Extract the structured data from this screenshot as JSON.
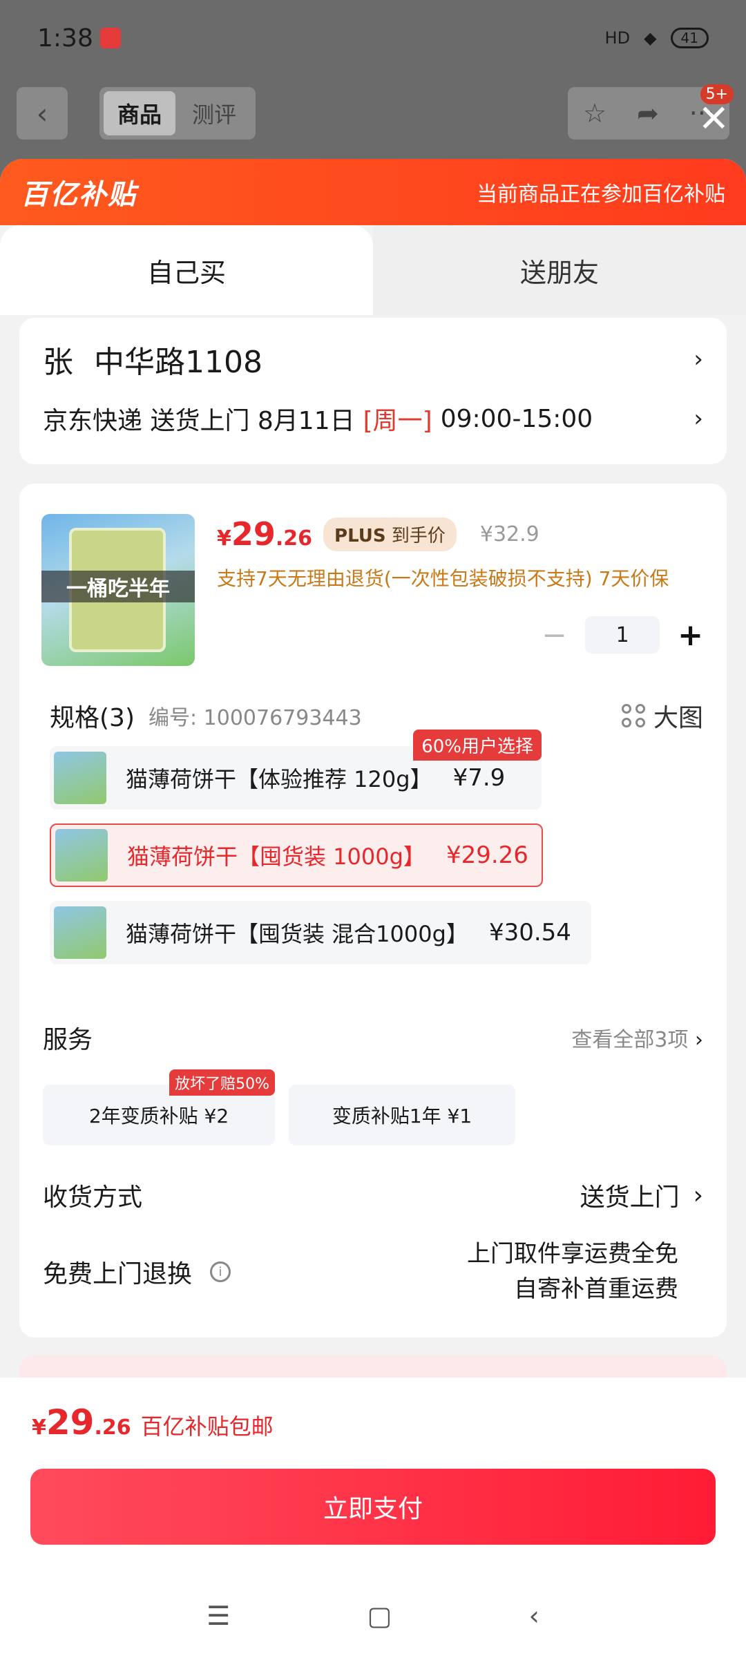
{
  "status": {
    "time": "1:38",
    "battery": "41",
    "signal": "HD"
  },
  "header": {
    "tab_active": "商品",
    "tab_inactive": "测评",
    "badge": "5+",
    "icons": [
      "back-icon",
      "star-icon",
      "share-icon",
      "more-icon",
      "close-icon"
    ]
  },
  "banner": {
    "logo": "百亿补贴",
    "text": "当前商品正在参加百亿补贴"
  },
  "tabs": {
    "self": "自己买",
    "friend": "送朋友"
  },
  "address": {
    "name": "张",
    "street": "中华路1108",
    "carrier": "京东快递 送货上门 8月11日",
    "weekday": "[周一]",
    "time": "09:00-15:00"
  },
  "product": {
    "image_overlay": "一桶吃半年",
    "price_symbol": "¥",
    "price_int": "29",
    "price_dec": ".26",
    "plus_label": "PLUS",
    "plus_text": "到手价",
    "old_price": "¥32.9",
    "return_note": "支持7天无理由退货(一次性包装破损不支持) 7天价保",
    "quantity": "1",
    "minus": "−",
    "plus": "+"
  },
  "spec": {
    "title": "规格(3)",
    "code": "编号: 100076793443",
    "big_image": "大图",
    "options": [
      {
        "name": "猫薄荷饼干【体验推荐 120g】",
        "price": "¥7.9",
        "tag": "60%用户选择"
      },
      {
        "name": "猫薄荷饼干【囤货装 1000g】",
        "price": "¥29.26"
      },
      {
        "name": "猫薄荷饼干【囤货装 混合1000g】",
        "price": "¥30.54"
      }
    ]
  },
  "service": {
    "title": "服务",
    "link": "查看全部3项",
    "options": [
      {
        "label": "2年变质补贴 ¥2",
        "tag": "放坏了赔50%"
      },
      {
        "label": "变质补贴1年 ¥1"
      }
    ]
  },
  "shipping": {
    "label": "收货方式",
    "value": "送货上门"
  },
  "free_return": {
    "label": "免费上门退换",
    "line1": "上门取件享运费全免",
    "line2": "自寄补首重运费"
  },
  "bottom": {
    "price_symbol": "¥",
    "price_int": "29",
    "price_dec": ".26",
    "note": "百亿补贴包邮",
    "pay": "立即支付"
  },
  "colors": {
    "accent": "#e6282c",
    "banner": "#ff4a1e",
    "pay": "#ff2a40"
  }
}
